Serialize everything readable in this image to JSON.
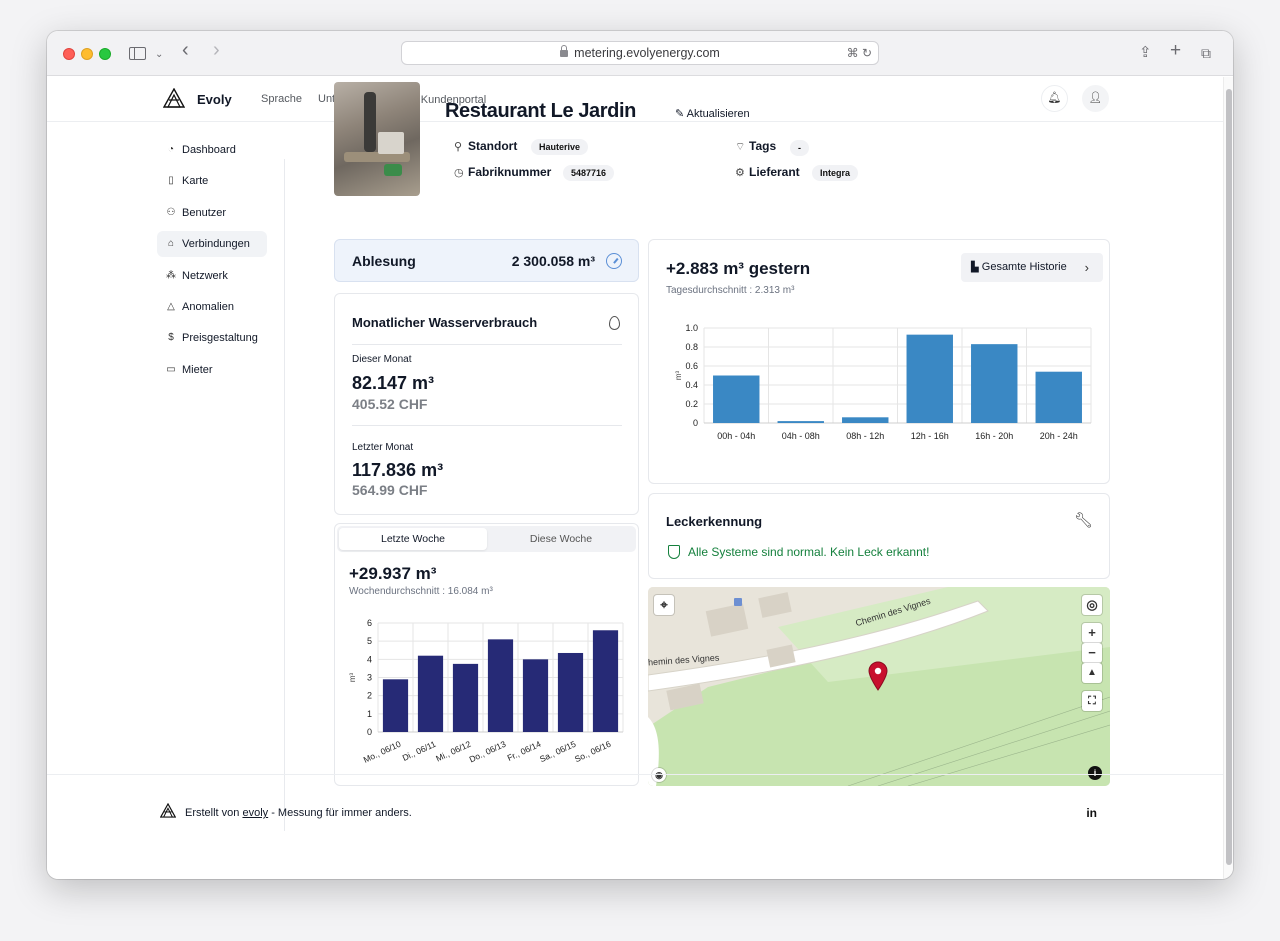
{
  "browser": {
    "url": "metering.evolyenergy.com"
  },
  "header": {
    "brand": "Evoly",
    "nav": [
      "Sprache",
      "Unterstützung",
      "Kundenportal"
    ]
  },
  "sidebar": {
    "items": [
      {
        "label": "Dashboard",
        "icon": "gauge-icon"
      },
      {
        "label": "Karte",
        "icon": "map-icon"
      },
      {
        "label": "Benutzer",
        "icon": "users-icon"
      },
      {
        "label": "Verbindungen",
        "icon": "home-icon",
        "active": true
      },
      {
        "label": "Netzwerk",
        "icon": "network-icon"
      },
      {
        "label": "Anomalien",
        "icon": "warning-icon"
      },
      {
        "label": "Preisgestaltung",
        "icon": "dollar-icon"
      },
      {
        "label": "Mieter",
        "icon": "id-card-icon"
      }
    ]
  },
  "connection": {
    "title": "Restaurant Le Jardin",
    "edit_label": "Aktualisieren",
    "standort_label": "Standort",
    "standort_value": "Hauterive",
    "fabrik_label": "Fabriknummer",
    "fabrik_value": "5487716",
    "tags_label": "Tags",
    "tags_value": "-",
    "lieferant_label": "Lieferant",
    "lieferant_value": "Integra"
  },
  "reading": {
    "label": "Ablesung",
    "value": "2 300.058 m³"
  },
  "monthly": {
    "title": "Monatlicher Wasserverbrauch",
    "this_month_label": "Dieser Monat",
    "this_month_volume": "82.147 m³",
    "this_month_cost": "405.52 CHF",
    "last_month_label": "Letzter Monat",
    "last_month_volume": "117.836 m³",
    "last_month_cost": "564.99 CHF"
  },
  "weekly": {
    "tab_active": "Letzte Woche",
    "tab_inactive": "Diese Woche",
    "total": "+29.937 m³",
    "average": "Wochendurchschnitt : 16.084 m³"
  },
  "daily": {
    "total": "+2.883 m³ gestern",
    "average": "Tagesdurchschnitt : 2.313 m³",
    "history_button": "Gesamte Historie"
  },
  "leak": {
    "title": "Leckerkennung",
    "status": "Alle Systeme sind normal. Kein Leck erkannt!"
  },
  "map": {
    "street_1": "Chemin des Vignes",
    "street_2": "hemin des Vignes"
  },
  "footer": {
    "text_before": "Erstellt von ",
    "link": "evoly",
    "text_after": " - Messung für immer anders.",
    "social": "in"
  },
  "colors": {
    "weekly_bar": "#262a76",
    "daily_bar": "#3a88c4",
    "leak_ok": "#15803d",
    "map_pin": "#c8102e"
  },
  "chart_data": [
    {
      "type": "bar",
      "categories": [
        "00h - 04h",
        "04h - 08h",
        "08h - 12h",
        "12h - 16h",
        "16h - 20h",
        "20h - 24h"
      ],
      "values": [
        0.5,
        0.02,
        0.06,
        0.93,
        0.83,
        0.54
      ],
      "ylabel": "m³",
      "ylim": [
        0,
        1
      ],
      "yticks": [
        0,
        0.2,
        0.4,
        0.6,
        0.8,
        1.0
      ],
      "ytick_labels": [
        "0",
        "0.2",
        "0.4",
        "0.6",
        "0.8",
        "1.0"
      ],
      "grid": true
    },
    {
      "type": "bar",
      "categories": [
        "Mo., 06/10",
        "Di., 06/11",
        "Mi., 06/12",
        "Do., 06/13",
        "Fr., 06/14",
        "Sa., 06/15",
        "So., 06/16"
      ],
      "values": [
        2.9,
        4.2,
        3.75,
        5.1,
        4.0,
        4.35,
        5.6
      ],
      "ylabel": "m³",
      "ylim": [
        0,
        6
      ],
      "yticks": [
        0,
        1,
        2,
        3,
        4,
        5,
        6
      ],
      "ytick_labels": [
        "0",
        "1",
        "2",
        "3",
        "4",
        "5",
        "6"
      ],
      "grid": true
    }
  ]
}
